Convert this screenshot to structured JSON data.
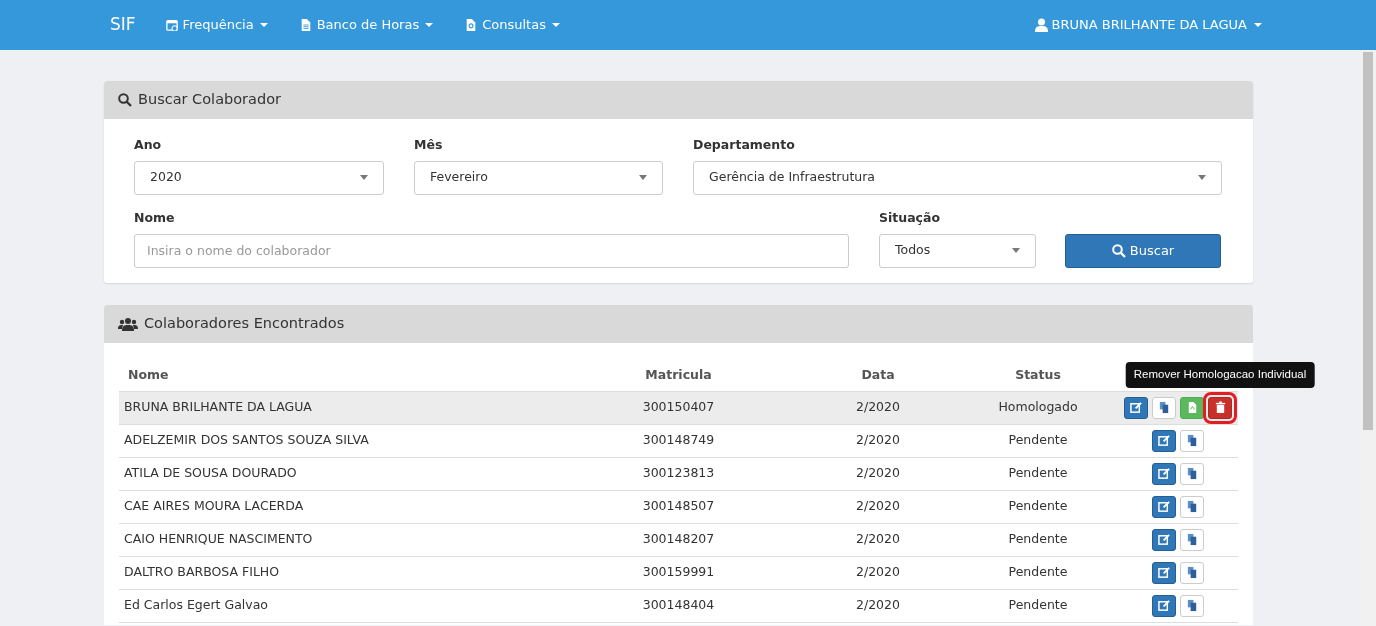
{
  "navbar": {
    "brand": "SIF",
    "menus": [
      {
        "label": "Frequência"
      },
      {
        "label": "Banco de Horas"
      },
      {
        "label": "Consultas"
      }
    ],
    "user": "BRUNA BRILHANTE DA LAGUA"
  },
  "search_panel": {
    "title": "Buscar Colaborador",
    "ano": {
      "label": "Ano",
      "value": "2020"
    },
    "mes": {
      "label": "Mês",
      "value": "Fevereiro"
    },
    "departamento": {
      "label": "Departamento",
      "value": "Gerência de Infraestrutura"
    },
    "nome": {
      "label": "Nome",
      "placeholder": "Insira o nome do colaborador"
    },
    "situacao": {
      "label": "Situação",
      "value": "Todos"
    },
    "button": "Buscar"
  },
  "results_panel": {
    "title": "Colaboradores Encontrados",
    "columns": [
      "Nome",
      "Matricula",
      "Data",
      "Status"
    ],
    "tooltip": "Remover Homologacao Individual",
    "rows": [
      {
        "nome": "BRUNA BRILHANTE DA LAGUA",
        "matricula": "300150407",
        "data": "2/2020",
        "status": "Homologado",
        "selected": true,
        "actions": [
          {
            "kind": "edit",
            "highlighted": false
          },
          {
            "kind": "copy",
            "highlighted": false
          },
          {
            "kind": "pdf",
            "highlighted": false
          },
          {
            "kind": "delete",
            "highlighted": true
          }
        ]
      },
      {
        "nome": "ADELZEMIR DOS SANTOS SOUZA SILVA",
        "matricula": "300148749",
        "data": "2/2020",
        "status": "Pendente",
        "selected": false,
        "actions": [
          {
            "kind": "edit",
            "highlighted": false
          },
          {
            "kind": "copy",
            "highlighted": false
          }
        ]
      },
      {
        "nome": "ATILA DE SOUSA DOURADO",
        "matricula": "300123813",
        "data": "2/2020",
        "status": "Pendente",
        "selected": false,
        "actions": [
          {
            "kind": "edit",
            "highlighted": false
          },
          {
            "kind": "copy",
            "highlighted": false
          }
        ]
      },
      {
        "nome": "CAE AIRES MOURA LACERDA",
        "matricula": "300148507",
        "data": "2/2020",
        "status": "Pendente",
        "selected": false,
        "actions": [
          {
            "kind": "edit",
            "highlighted": false
          },
          {
            "kind": "copy",
            "highlighted": false
          }
        ]
      },
      {
        "nome": "CAIO HENRIQUE NASCIMENTO",
        "matricula": "300148207",
        "data": "2/2020",
        "status": "Pendente",
        "selected": false,
        "actions": [
          {
            "kind": "edit",
            "highlighted": false
          },
          {
            "kind": "copy",
            "highlighted": false
          }
        ]
      },
      {
        "nome": "DALTRO BARBOSA FILHO",
        "matricula": "300159991",
        "data": "2/2020",
        "status": "Pendente",
        "selected": false,
        "actions": [
          {
            "kind": "edit",
            "highlighted": false
          },
          {
            "kind": "copy",
            "highlighted": false
          }
        ]
      },
      {
        "nome": "Ed Carlos Egert Galvao",
        "matricula": "300148404",
        "data": "2/2020",
        "status": "Pendente",
        "selected": false,
        "actions": [
          {
            "kind": "edit",
            "highlighted": false
          },
          {
            "kind": "copy",
            "highlighted": false
          }
        ]
      }
    ]
  }
}
